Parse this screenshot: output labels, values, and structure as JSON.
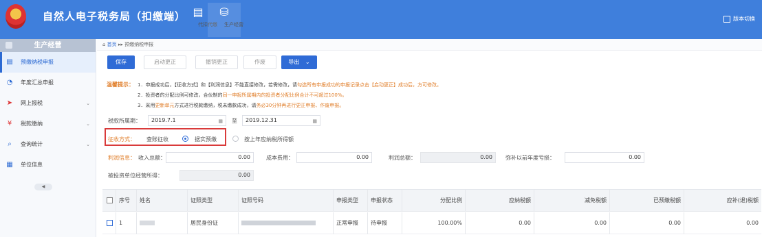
{
  "header": {
    "emblem_text": "",
    "title": "自然人电子税务局（扣缴端）",
    "nav": [
      {
        "label": "代扣代缴",
        "icon": "clipboard-icon"
      },
      {
        "label": "生产经营",
        "icon": "database-icon"
      }
    ],
    "version_switch": "版本切换"
  },
  "sidebar": {
    "title": "生产经营",
    "items": [
      {
        "label": "预缴纳税申报",
        "icon": "document-icon",
        "active": true
      },
      {
        "label": "年度汇总申报",
        "icon": "clock-icon"
      },
      {
        "label": "网上报税",
        "icon": "send-icon",
        "chevron": "⌄"
      },
      {
        "label": "税款缴纳",
        "icon": "money-icon",
        "chevron": "⌄"
      },
      {
        "label": "查询统计",
        "icon": "search-icon",
        "chevron": "⌄"
      },
      {
        "label": "单位信息",
        "icon": "building-icon"
      }
    ],
    "collapse_glyph": "◀"
  },
  "breadcrumb": {
    "home": "首页",
    "separator": "▸▸",
    "current": "预缴纳税申报"
  },
  "toolbar": {
    "save": "保存",
    "start_correction": "启动更正",
    "cancel_correction": "撤销更正",
    "void": "作废",
    "export": "导出",
    "export_chevron": "⌄"
  },
  "notice": {
    "label": "温馨提示：",
    "line1_a": "1．申报成功后，【征收方式】和【利润信息】不能直接修改，若需修改，请",
    "line1_b": "勾选所有申报成功的申报记录点击【启动更正】成功后，方可修改。",
    "line2_a": "2．投资者的分配比例可修改，合伙制的",
    "line2_b": "同一申报所属期内的投资者分配比例合计不可超过100%。",
    "line3_a": "3．采用",
    "line3_b": "更新单元",
    "line3_c": "方式进行税款缴纳，税未缴款成功，请",
    "line3_d": "务必30分钟再进行更正申报、作废申报。"
  },
  "form": {
    "period_label": "税款所属期：",
    "period_start": "2019.7.1",
    "period_to": "至",
    "period_end": "2019.12.31",
    "calendar_glyph": "▦",
    "levy_label": "征收方式：",
    "levy_options": [
      "查账征收",
      "据实预缴",
      "按上年应纳税所得额"
    ],
    "levy_selected": 1,
    "profit_label": "利润信息：",
    "income_label": "收入总额：",
    "income_value": "0.00",
    "cost_label": "成本费用：",
    "cost_value": "0.00",
    "profit_total_label": "利润总额：",
    "profit_total_value": "0.00",
    "loss_label": "弥补以前年度亏损：",
    "loss_value": "0.00",
    "invest_label": "被投资单位经营所得：",
    "invest_value": "0.00"
  },
  "table": {
    "headers": [
      "序号",
      "姓名",
      "证照类型",
      "证照号码",
      "申报类型",
      "申报状态",
      "分配比例",
      "应纳税额",
      "减免税额",
      "已预缴税额",
      "应补(退)税额"
    ],
    "rows": [
      {
        "index": "1",
        "id_type": "居民身份证",
        "declare_type": "正常申报",
        "status": "待申报",
        "ratio": "100.00%",
        "tax": "0.00",
        "relief": "0.00",
        "prepaid": "0.00",
        "due": "0.00"
      }
    ]
  },
  "colors": {
    "header_bg": "#3f7fdc",
    "primary": "#2f6bd6",
    "warning": "#e07e2a",
    "highlight_box": "#d93a3a"
  }
}
